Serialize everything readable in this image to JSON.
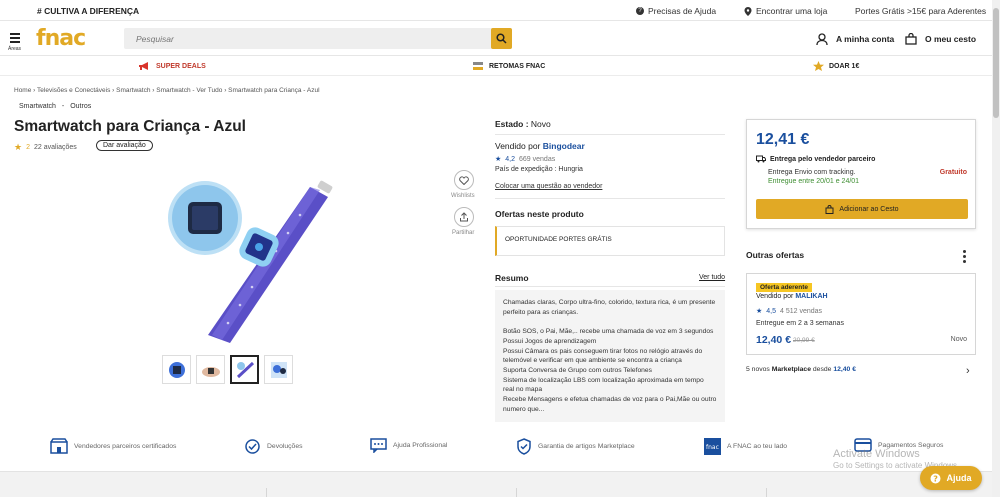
{
  "topbar": {
    "slogan": "# CULTIVA A DIFERENÇA",
    "help": "Precisas de Ajuda",
    "store": "Encontrar uma loja",
    "shipping": "Portes Grátis >15€ para Aderentes"
  },
  "header": {
    "menu_label": "Áreas",
    "logo": "fnac",
    "search_placeholder": "Pesquisar",
    "account": "A minha conta",
    "cart": "O meu cesto"
  },
  "nav": {
    "items": [
      {
        "label": "SUPER DEALS",
        "icon": "megaphone-icon"
      },
      {
        "label": "RETOMAS FNAC",
        "icon": "trade-in-icon"
      },
      {
        "label": "DOAR 1€",
        "icon": "star-donate-icon"
      }
    ]
  },
  "breadcrumb": [
    "Home",
    "Televisões e Conectáveis",
    "Smartwatch",
    "Smartwatch - Ver Tudo",
    "Smartwatch para Criança - Azul"
  ],
  "subcrumb": [
    "Smartwatch",
    "Outros"
  ],
  "product": {
    "title": "Smartwatch para Criança - Azul",
    "rating": "2",
    "reviews": "22 avaliações",
    "review_button": "Dar avaliação",
    "wishlist": "Wishlists",
    "share": "Partilhar"
  },
  "details": {
    "estado_label": "Estado :",
    "estado_value": "Novo",
    "sold_by": "Vendido por",
    "seller": "Bingodear",
    "seller_rating": "4,2",
    "seller_sales": "669 vendas",
    "expedition": "País de expedição : Hungria",
    "ask": "Colocar uma questão ao vendedor",
    "offers_title": "Ofertas neste produto",
    "offer_text": "OPORTUNIDADE PORTES GRÁTIS",
    "summary_title": "Resumo",
    "see_all": "Ver tudo",
    "summary_lines": [
      "Chamadas claras, Corpo ultra-fino, colorido, textura rica, é um presente",
      "perfeito para as crianças.",
      "",
      "Botão SOS, o Pai, Mãe,.. recebe uma chamada de voz em 3 segundos",
      "Possui Jogos de aprendizagem",
      "Possui Câmara os pais conseguem tirar fotos no relógio através do",
      "telemóvel e verificar em que ambiente se encontra a criança",
      "Suporta Conversa de Grupo com outros Telefones",
      "Sistema de localização LBS com localização aproximada em tempo",
      "real no mapa",
      "Recebe Mensagens e efetua chamadas de voz para o Pai,Mãe ou outro",
      "numero que..."
    ]
  },
  "buybox": {
    "price": "12,41 €",
    "delivery_title": "Entrega pelo vendedor parceiro",
    "delivery_type": "Entrega Envio com tracking.",
    "delivery_dates": "Entregue entre 20/01 e 24/01",
    "delivery_price": "Gratuito",
    "add_to_cart": "Adicionar ao Cesto"
  },
  "other_offers": {
    "title": "Outras ofertas",
    "badge": "Oferta aderente",
    "sold_by": "Vendido por",
    "seller": "MALIKAH",
    "rating": "4,5",
    "sales": "4 512 vendas",
    "delivery": "Entregue em 2 a 3 semanas",
    "price": "12,40 €",
    "old_price": "20,99 €",
    "condition": "Novo",
    "more_prefix": "5 novos",
    "more_market": "Marketplace",
    "more_from": "desde",
    "more_price": "12,40 €"
  },
  "features": [
    {
      "label": "Vendedores parceiros certificados"
    },
    {
      "label": "Devoluções"
    },
    {
      "label": "Ajuda Profissional"
    },
    {
      "label": "Garantia de artigos Marketplace"
    },
    {
      "label": "A FNAC ao teu lado"
    },
    {
      "label": "Pagamentos Seguros"
    }
  ],
  "watermark": {
    "line1": "Activate Windows",
    "line2": "Go to Settings to activate Windows."
  },
  "help_button": "Ajuda",
  "colors": {
    "brand": "#e1a925",
    "link_blue": "#1a4f9e",
    "free_red": "#c0392b",
    "delivery_green": "#3e8e32"
  }
}
